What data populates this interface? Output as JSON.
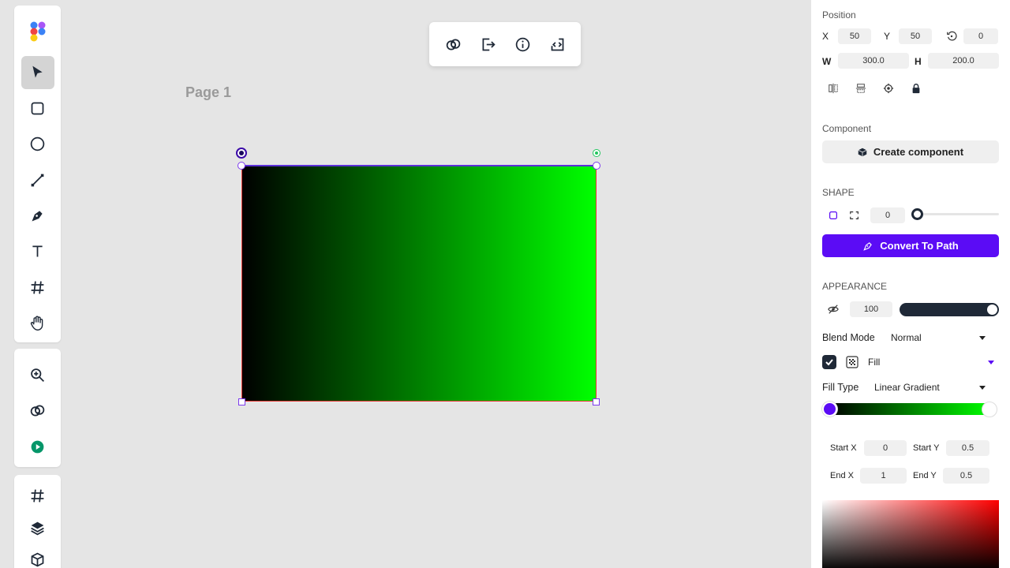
{
  "canvas": {
    "page_label": "Page 1",
    "shape_fill": {
      "type": "linear-gradient",
      "start_color": "#000000",
      "end_color": "#00ff00"
    },
    "selection_color": "#5b2fd8"
  },
  "left_toolbar": {
    "logo": "app-logo",
    "tools": [
      {
        "name": "select-tool",
        "icon": "cursor-icon",
        "active": true
      },
      {
        "name": "rectangle-tool",
        "icon": "rectangle-icon"
      },
      {
        "name": "ellipse-tool",
        "icon": "circle-icon"
      },
      {
        "name": "line-tool",
        "icon": "line-icon"
      },
      {
        "name": "pen-tool",
        "icon": "pen-icon"
      },
      {
        "name": "text-tool",
        "icon": "text-icon"
      },
      {
        "name": "frame-tool",
        "icon": "hash-icon"
      },
      {
        "name": "hand-tool",
        "icon": "hand-icon"
      }
    ],
    "mid_tools": [
      {
        "name": "zoom-tool",
        "icon": "zoom-in-icon"
      },
      {
        "name": "boolean-tool",
        "icon": "rings-icon"
      },
      {
        "name": "play-tool",
        "icon": "play-icon"
      }
    ],
    "bottom_tools": [
      {
        "name": "frames-panel",
        "icon": "hash-icon"
      },
      {
        "name": "layers-panel",
        "icon": "layers-icon"
      },
      {
        "name": "components-panel",
        "icon": "box-icon"
      }
    ]
  },
  "float_toolbar": [
    {
      "name": "link-button",
      "icon": "rings-icon"
    },
    {
      "name": "export-button",
      "icon": "export-icon"
    },
    {
      "name": "info-button",
      "icon": "info-icon"
    },
    {
      "name": "code-button",
      "icon": "code-icon"
    }
  ],
  "panel": {
    "position": {
      "title": "Position",
      "x_label": "X",
      "x_value": "50",
      "y_label": "Y",
      "y_value": "50",
      "rotation_value": "0",
      "w_label": "W",
      "w_value": "300.0",
      "h_label": "H",
      "h_value": "200.0"
    },
    "component": {
      "title": "Component",
      "create_label": "Create component"
    },
    "shape": {
      "title": "SHAPE",
      "radius_value": "0",
      "radius_fraction": 0,
      "convert_label": "Convert To Path"
    },
    "appearance": {
      "title": "APPEARANCE",
      "opacity_value": "100",
      "opacity_fraction": 1.0,
      "blend_label": "Blend Mode",
      "blend_value": "Normal",
      "fill_label": "Fill",
      "fill_type_label": "Fill Type",
      "fill_type_value": "Linear Gradient",
      "start_x_label": "Start X",
      "start_x_value": "0",
      "start_y_label": "Start Y",
      "start_y_value": "0.5",
      "end_x_label": "End X",
      "end_x_value": "1",
      "end_y_label": "End Y",
      "end_y_value": "0.5"
    },
    "accent_color": "#5b0cf5"
  }
}
